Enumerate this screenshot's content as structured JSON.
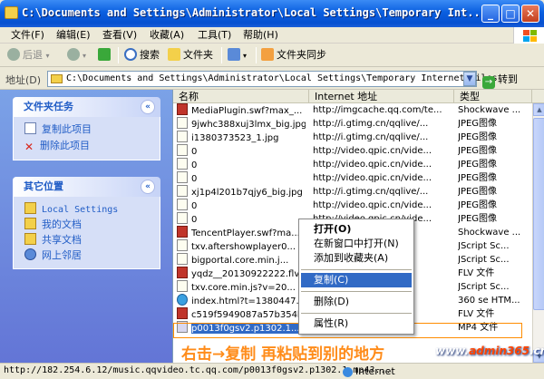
{
  "window": {
    "title": "C:\\Documents and Settings\\Administrator\\Local Settings\\Temporary Int...",
    "min": "_",
    "max": "□",
    "close": "✕"
  },
  "menu": [
    "文件(F)",
    "编辑(E)",
    "查看(V)",
    "收藏(A)",
    "工具(T)",
    "帮助(H)"
  ],
  "toolbar": {
    "back": "后退",
    "search": "搜索",
    "folders": "文件夹",
    "sync": "文件夹同步",
    "arrow_down": "▾",
    "forward_symbol": "→"
  },
  "address": {
    "label": "地址(D)",
    "value": "C:\\Documents and Settings\\Administrator\\Local Settings\\Temporary Internet Files",
    "go": "转到",
    "dropdown": "▼"
  },
  "tasks_panel": {
    "title": "文件夹任务",
    "toggle": "«",
    "items": [
      "复制此项目",
      "删除此项目"
    ]
  },
  "places_panel": {
    "title": "其它位置",
    "toggle": "«",
    "items": [
      "Local Settings",
      "我的文档",
      "共享文档",
      "网上邻居"
    ]
  },
  "columns": [
    "名称",
    "Internet 地址",
    "类型"
  ],
  "rows": [
    {
      "name": "MediaPlugin.swf?max_...",
      "url": "http://imgcache.qq.com/te...",
      "type": "Shockwave ...",
      "icon": "flv"
    },
    {
      "name": "9jwhc388xuj3lmx_big.jpg",
      "url": "http://i.gtimg.cn/qqlive/...",
      "type": "JPEG图像",
      "icon": "doc"
    },
    {
      "name": "i1380373523_1.jpg",
      "url": "http://i.gtimg.cn/qqlive/...",
      "type": "JPEG图像",
      "icon": "doc"
    },
    {
      "name": "0",
      "url": "http://video.qpic.cn/vide...",
      "type": "JPEG图像",
      "icon": "doc"
    },
    {
      "name": "0",
      "url": "http://video.qpic.cn/vide...",
      "type": "JPEG图像",
      "icon": "doc"
    },
    {
      "name": "0",
      "url": "http://video.qpic.cn/vide...",
      "type": "JPEG图像",
      "icon": "doc"
    },
    {
      "name": "xj1p4l201b7qjy6_big.jpg",
      "url": "http://i.gtimg.cn/qqlive/...",
      "type": "JPEG图像",
      "icon": "doc"
    },
    {
      "name": "0",
      "url": "http://video.qpic.cn/vide...",
      "type": "JPEG图像",
      "icon": "doc"
    },
    {
      "name": "0",
      "url": "http://video.qpic.cn/vide...",
      "type": "JPEG图像",
      "icon": "doc"
    },
    {
      "name": "TencentPlayer.swf?ma...",
      "url": "...m/show...",
      "type": "Shockwave ...",
      "icon": "flv"
    },
    {
      "name": "txv.aftershowplayer0...",
      "url": "...m/qql...",
      "type": "JScript Sc...",
      "icon": "doc"
    },
    {
      "name": "bigportal.core.min.j...",
      "url": "...m/qql...",
      "type": "JScript Sc...",
      "icon": "doc"
    },
    {
      "name": "yqdz__20130922222.flv",
      "url": "...o/...",
      "type": "FLV 文件",
      "icon": "flv"
    },
    {
      "name": "txv.core.min.js?v=20...",
      "url": "...m/qql...",
      "type": "JScript Sc...",
      "icon": "doc"
    },
    {
      "name": "index.html?t=1380447...",
      "url": "...n/bi...",
      "type": "360 se HTM...",
      "icon": "ie"
    },
    {
      "name": "c519f5949087a57b354b...",
      "url": "...a...",
      "type": "FLV 文件",
      "icon": "flv"
    },
    {
      "name": "p0013f0gsv2.p1302.1....",
      "url": "...usic...",
      "type": "MP4 文件",
      "icon": "mp4"
    }
  ],
  "context_menu": {
    "items": [
      "打开(O)",
      "在新窗口中打开(N)",
      "添加到收藏夹(A)",
      "复制(C)",
      "删除(D)",
      "属性(R)"
    ]
  },
  "caption": "右击→复制 再粘贴到别的地方",
  "watermark": {
    "prefix": "www.",
    "domain": "admin365",
    "suffix": ".cn"
  },
  "status": {
    "url": "http://182.254.6.12/music.qqvideo.tc.qq.com/p0013f0gsv2.p1302.1.mp4?...",
    "zone": "Internet"
  },
  "colors": {
    "titlebar": "#0a5fe0",
    "selection": "#316ac5",
    "caption": "#ff8c1a",
    "panel_head": "#215dc6"
  }
}
